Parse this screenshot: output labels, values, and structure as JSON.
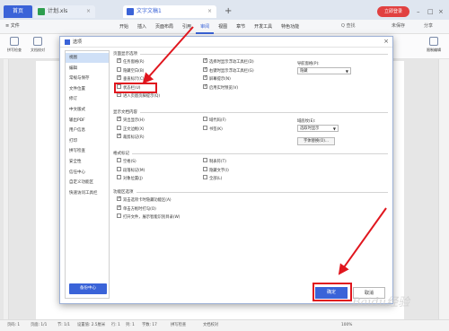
{
  "tabbar": {
    "home": "首页",
    "tab1": "计划.xls",
    "tab2": "文字文稿1",
    "login": "立即登录"
  },
  "ribbon": {
    "file": "≡ 文件",
    "items": [
      "开始",
      "插入",
      "页面布局",
      "引用",
      "审阅",
      "视图",
      "章节",
      "开发工具",
      "特色功能"
    ],
    "active_index": 4,
    "search": "Q 查找",
    "collab": "未保存",
    "share": "分享"
  },
  "toolbar": {
    "left": [
      "拼写检查",
      "文档校对"
    ],
    "right": "限制编辑"
  },
  "dialog": {
    "title": "选项",
    "nav": [
      "视图",
      "编辑",
      "常规与保存",
      "文件位置",
      "修订",
      "中文版式",
      "输出PDF",
      "用户信息",
      "打印",
      "拼写检查",
      "安全性",
      "信任中心",
      "自定义功能区",
      "快速访问工具栏"
    ],
    "nav_selected": 0,
    "backup": "备份中心",
    "ok": "确定",
    "cancel": "取消",
    "groups": {
      "page_display": "页面显示选项",
      "show_content": "显示文档内容",
      "format_marks": "格式标记",
      "func_options": "功能区选项"
    },
    "page_display_left": [
      {
        "label": "任务窗格(R)",
        "on": true
      },
      {
        "label": "隐藏空白(B)",
        "on": false
      },
      {
        "label": "垂直标尺(C)",
        "on": true
      },
      {
        "label": "状态栏(U)",
        "on": false
      },
      {
        "label": "进入页眉页脚提示(Q)",
        "on": true
      }
    ],
    "page_display_mid": [
      {
        "label": "选择时显示浮动工具栏(D)",
        "on": true
      },
      {
        "label": "右键时显示浮动工具栏(G)",
        "on": true
      },
      {
        "label": "屏幕提示(N)",
        "on": true
      },
      {
        "label": "启用实时预览(V)",
        "on": true
      }
    ],
    "nav_pane_label": "导航窗格(P):",
    "nav_pane_value": "隐藏",
    "show_content_left": [
      {
        "label": "突出显示(H)",
        "on": true
      },
      {
        "label": "正文边框(X)",
        "on": false
      },
      {
        "label": "裁剪标记(R)",
        "on": true
      }
    ],
    "show_content_mid": [
      {
        "label": "域代码(F)",
        "on": false
      },
      {
        "label": "书签(K)",
        "on": false
      }
    ],
    "field_shading_label": "域底纹(E):",
    "field_shading_value": "选取时显示",
    "font_replace": "字体替换(O)...",
    "format_marks_left": [
      {
        "label": "空格(S)",
        "on": false
      },
      {
        "label": "段落标记(M)",
        "on": false
      },
      {
        "label": "对象位置(J)",
        "on": false
      }
    ],
    "format_marks_mid": [
      {
        "label": "制表符(T)",
        "on": false
      },
      {
        "label": "隐藏文字(I)",
        "on": false
      },
      {
        "label": "全部(L)",
        "on": false
      }
    ],
    "func_options": [
      {
        "label": "双击选项卡时隐藏功能区(A)",
        "on": true
      },
      {
        "label": "单击方框时打勾(O)",
        "on": true
      },
      {
        "label": "打开文件，展示智能识别目录(W)",
        "on": false
      }
    ]
  },
  "statusbar": {
    "page": "页码: 1",
    "pages": "页面: 1/1",
    "section": "节: 1/1",
    "settings": "设置值: 2.5厘米",
    "row": "行: 1",
    "col": "列: 1",
    "words": "字数: 17",
    "spell": "拼写检查",
    "proof": "文档校对",
    "zoom": "100%"
  },
  "watermark": "Baidu经验"
}
